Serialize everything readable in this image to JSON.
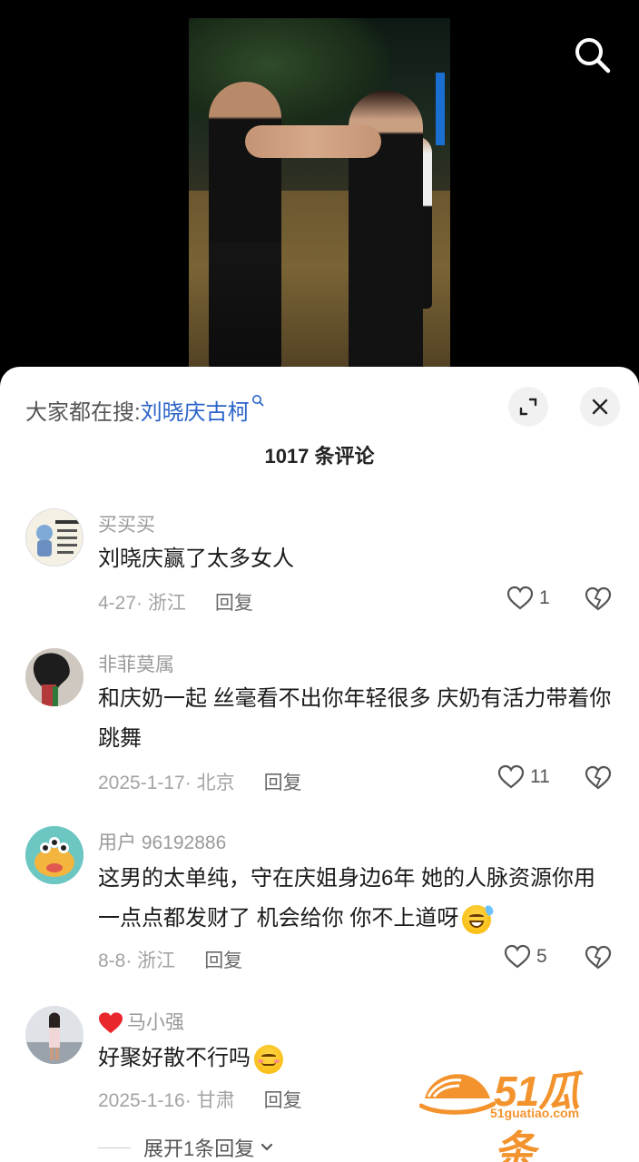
{
  "video": {
    "search_icon": "search-icon"
  },
  "sheet": {
    "hot_search_prefix": "大家都在搜:",
    "hot_search_keyword": "刘晓庆古柯",
    "expand_icon": "expand-icon",
    "close_icon": "close-icon",
    "comment_count": "1017 条评论"
  },
  "comments": [
    {
      "username": "买买买",
      "text": "刘晓庆赢了太多女人",
      "date_location": "4-27· 浙江",
      "reply_label": "回复",
      "likes": "1"
    },
    {
      "username": "非菲莫属",
      "text": "和庆奶一起 丝毫看不出你年轻很多 庆奶有活力带着你跳舞",
      "date_location": "2025-1-17· 北京",
      "reply_label": "回复",
      "likes": "11"
    },
    {
      "username": "用户 96192886",
      "text": "这男的太单纯，守在庆姐身边6年 她的人脉资源你用一点点都发财了 机会给你 你不上道呀",
      "date_location": "8-8· 浙江",
      "reply_label": "回复",
      "likes": "5"
    },
    {
      "username": "马小强",
      "text": "好聚好散不行吗",
      "date_location": "2025-1-16· 甘肃",
      "reply_label": "回复"
    }
  ],
  "expand_replies": "展开1条回复",
  "watermark": {
    "brand": "51瓜条",
    "url": "51guatiao.com"
  },
  "colors": {
    "keyword_blue": "#2b63c9",
    "heart_red": "#e8262b",
    "watermark_orange": "#f38a1c"
  }
}
